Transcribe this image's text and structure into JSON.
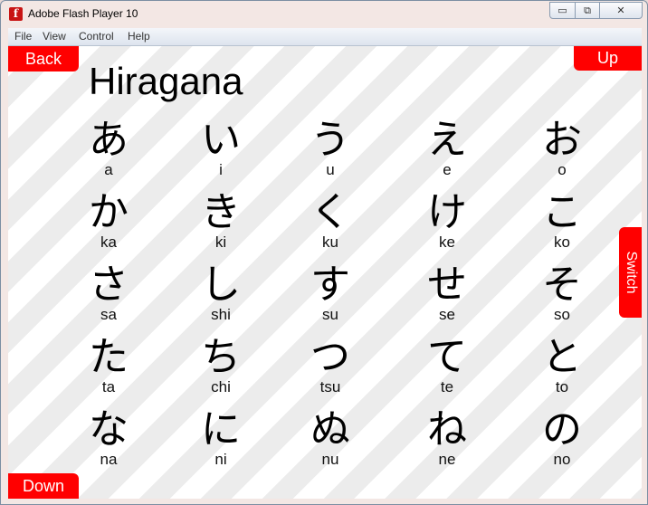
{
  "window": {
    "title": "Adobe Flash Player 10",
    "icon": "flash-icon",
    "controls": {
      "minimize": "▭",
      "maximize": "⧉",
      "close": "✕"
    }
  },
  "menu": [
    "File",
    "View",
    "Control",
    "Help"
  ],
  "buttons": {
    "back": "Back",
    "up": "Up",
    "down": "Down",
    "switch": "Switch"
  },
  "colors": {
    "button": "#ff0000",
    "stripe_light": "#ffffff",
    "stripe_dark": "#ececec"
  },
  "heading": "Hiragana",
  "grid": [
    [
      {
        "kana": "あ",
        "romaji": "a"
      },
      {
        "kana": "い",
        "romaji": "i"
      },
      {
        "kana": "う",
        "romaji": "u"
      },
      {
        "kana": "え",
        "romaji": "e"
      },
      {
        "kana": "お",
        "romaji": "o"
      }
    ],
    [
      {
        "kana": "か",
        "romaji": "ka"
      },
      {
        "kana": "き",
        "romaji": "ki"
      },
      {
        "kana": "く",
        "romaji": "ku"
      },
      {
        "kana": "け",
        "romaji": "ke"
      },
      {
        "kana": "こ",
        "romaji": "ko"
      }
    ],
    [
      {
        "kana": "さ",
        "romaji": "sa"
      },
      {
        "kana": "し",
        "romaji": "shi"
      },
      {
        "kana": "す",
        "romaji": "su"
      },
      {
        "kana": "せ",
        "romaji": "se"
      },
      {
        "kana": "そ",
        "romaji": "so"
      }
    ],
    [
      {
        "kana": "た",
        "romaji": "ta"
      },
      {
        "kana": "ち",
        "romaji": "chi"
      },
      {
        "kana": "つ",
        "romaji": "tsu"
      },
      {
        "kana": "て",
        "romaji": "te"
      },
      {
        "kana": "と",
        "romaji": "to"
      }
    ],
    [
      {
        "kana": "な",
        "romaji": "na"
      },
      {
        "kana": "に",
        "romaji": "ni"
      },
      {
        "kana": "ぬ",
        "romaji": "nu"
      },
      {
        "kana": "ね",
        "romaji": "ne"
      },
      {
        "kana": "の",
        "romaji": "no"
      }
    ]
  ]
}
